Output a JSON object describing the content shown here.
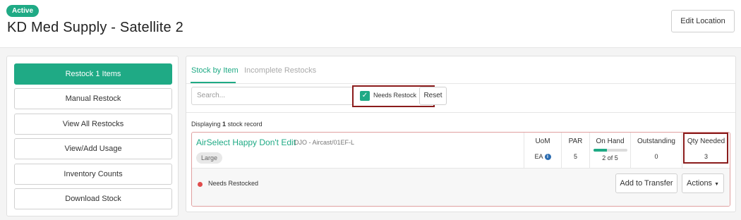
{
  "header": {
    "status_badge": "Active",
    "title": "KD Med Supply - Satellite 2",
    "edit_button": "Edit Location"
  },
  "sidebar": {
    "buttons": [
      {
        "label": "Restock 1 Items"
      },
      {
        "label": "Manual Restock"
      },
      {
        "label": "View All Restocks"
      },
      {
        "label": "View/Add Usage"
      },
      {
        "label": "Inventory Counts"
      },
      {
        "label": "Download Stock"
      }
    ]
  },
  "tabs": [
    {
      "label": "Stock by Item",
      "active": true
    },
    {
      "label": "Incomplete Restocks",
      "active": false
    }
  ],
  "filters": {
    "search_placeholder": "Search...",
    "needs_restock_label": "Needs Restock",
    "needs_restock_checked": true,
    "reset_label": "Reset"
  },
  "displaying": {
    "prefix": "Displaying",
    "count": "1",
    "suffix": "stock record"
  },
  "record": {
    "name": "AirSelect Happy Don't Edit",
    "sub": "DJO - Aircast/01EF-L",
    "size": "Large",
    "columns": {
      "uom": {
        "header": "UoM",
        "value": "EA"
      },
      "par": {
        "header": "PAR",
        "value": "5"
      },
      "on_hand": {
        "header": "On Hand",
        "value": "2 of 5",
        "fraction": 0.4
      },
      "outstanding": {
        "header": "Outstanding",
        "value": "0"
      },
      "qty_needed": {
        "header": "Qty Needed",
        "value": "3"
      }
    },
    "status": "Needs Restocked",
    "add_to_transfer": "Add to Transfer",
    "actions": "Actions"
  },
  "colors": {
    "accent": "#1faa85",
    "alert_red": "#e04b4b",
    "highlight_border": "#8b1c1c",
    "info_blue": "#2b6cb0"
  }
}
